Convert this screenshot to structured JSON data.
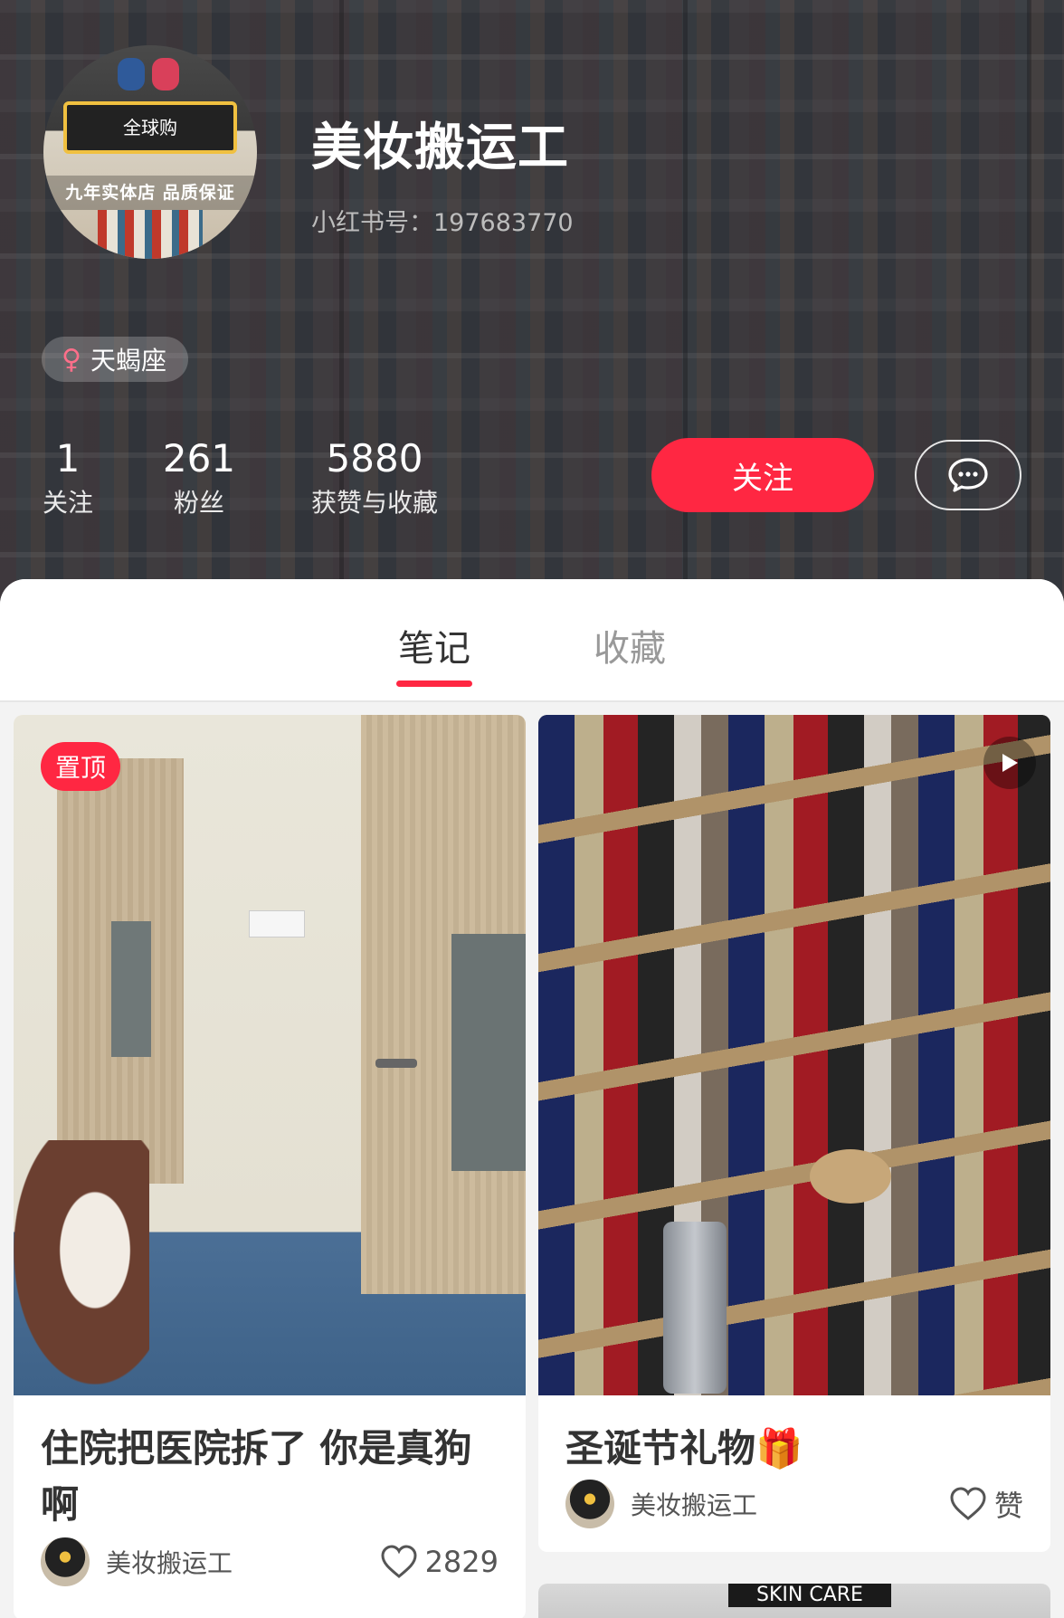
{
  "profile": {
    "name": "美妆搬运工",
    "xhs_id": "小红书号：197683770",
    "avatar": {
      "sign_text": "全球购",
      "band_text": "九年实体店 品质保证"
    },
    "gender_icon": "female-symbol-icon",
    "gender_glyph": "♀",
    "zodiac": "天蝎座",
    "stats": [
      {
        "num": "1",
        "label": "关注"
      },
      {
        "num": "261",
        "label": "粉丝"
      },
      {
        "num": "5880",
        "label": "获赞与收藏"
      }
    ],
    "follow_label": "关注",
    "message_icon": "chat-bubble-icon"
  },
  "tabs": {
    "notes": "笔记",
    "favorites": "收藏",
    "active": "notes"
  },
  "notes": [
    {
      "pinned_label": "置顶",
      "title": "住院把医院拆了 你是真狗啊",
      "author": "美妆搬运工",
      "likes": "2829"
    },
    {
      "title": "圣诞节礼物🎁",
      "author": "美妆搬运工",
      "likes": "赞",
      "video_icon": "play-icon"
    }
  ],
  "next_card": {
    "partial_text": "SKIN CARE"
  },
  "colors": {
    "accent": "#ff2742",
    "header_overlay": "#232326",
    "page_bg": "#f3f3f3"
  }
}
